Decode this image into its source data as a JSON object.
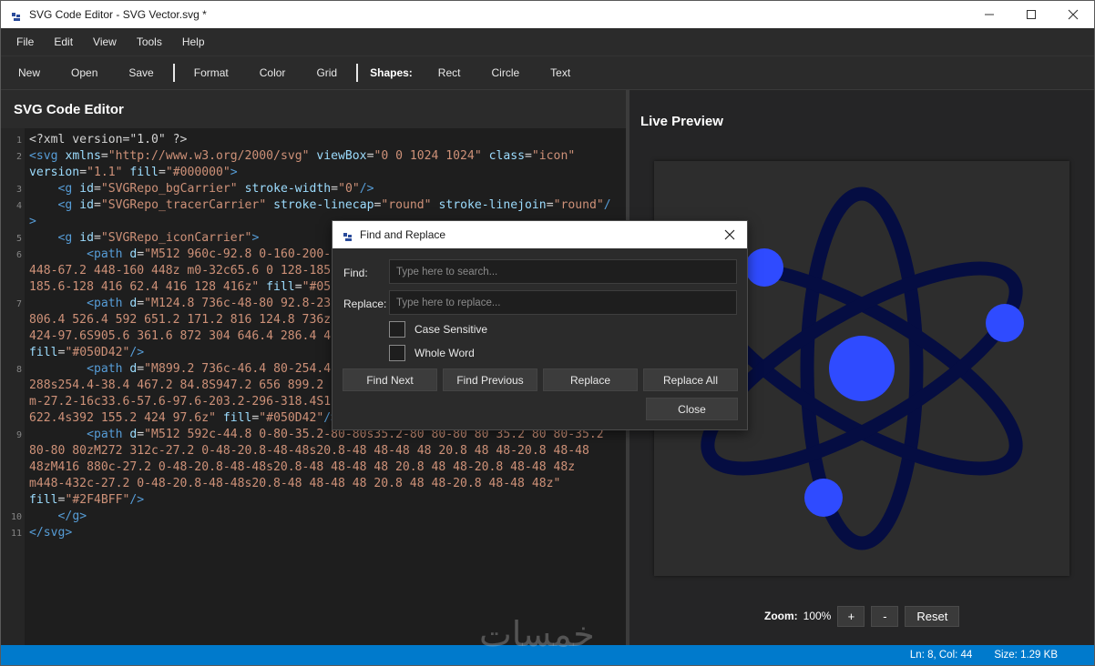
{
  "window": {
    "title": "SVG Code Editor - SVG Vector.svg *",
    "controls": [
      "minimize-icon",
      "maximize-icon",
      "close-icon"
    ]
  },
  "menu": [
    "File",
    "Edit",
    "View",
    "Tools",
    "Help"
  ],
  "toolbar": {
    "file_buttons": [
      "New",
      "Open",
      "Save"
    ],
    "edit_buttons": [
      "Format",
      "Color",
      "Grid"
    ],
    "shapes_label": "Shapes:",
    "shape_buttons": [
      "Rect",
      "Circle",
      "Text"
    ]
  },
  "editor": {
    "title": "SVG Code Editor",
    "line_numbers": [
      "1",
      "2",
      "3",
      "4",
      "5",
      "6",
      "7",
      "8",
      "9",
      "10",
      "11"
    ]
  },
  "preview": {
    "title": "Live Preview",
    "zoom_label": "Zoom:",
    "zoom_value": "100%",
    "zoom_in": "+",
    "zoom_out": "-",
    "reset": "Reset",
    "colors": {
      "orbit": "#050D42",
      "electron": "#2F4BFF",
      "canvas": "#2d2d2d"
    }
  },
  "status": {
    "position": "Ln: 8, Col: 44",
    "size": "Size: 1.29 KB"
  },
  "find_replace": {
    "title": "Find and Replace",
    "find_label": "Find:",
    "find_value": "",
    "find_placeholder": "Type here to search...",
    "replace_label": "Replace:",
    "replace_value": "",
    "replace_placeholder": "Type here to replace...",
    "case_sensitive": "Case Sensitive",
    "whole_word": "Whole Word",
    "find_next": "Find Next",
    "find_previous": "Find Previous",
    "replace": "Replace",
    "replace_all": "Replace All",
    "close": "Close"
  },
  "watermark": "خمسات"
}
